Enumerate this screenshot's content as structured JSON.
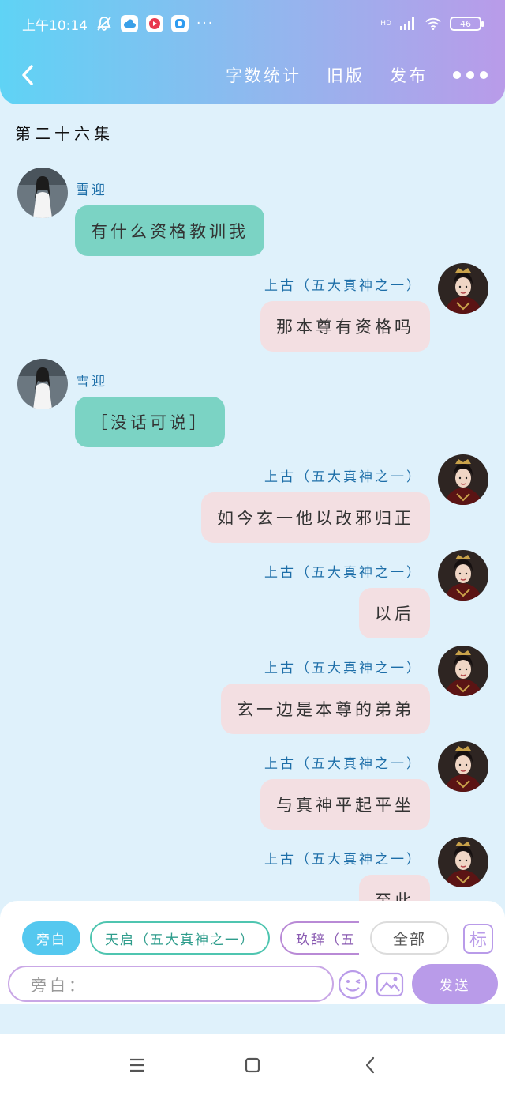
{
  "status_bar": {
    "time": "上午10:14",
    "more": "···",
    "network": "HD",
    "battery": "46"
  },
  "header": {
    "actions": [
      "字数统计",
      "旧版",
      "发布"
    ]
  },
  "episode_title": "第二十六集",
  "messages": [
    {
      "side": "left",
      "name": "雪迎",
      "text": "有什么资格教训我"
    },
    {
      "side": "right",
      "name": "上古（五大真神之一）",
      "text": "那本尊有资格吗"
    },
    {
      "side": "left",
      "name": "雪迎",
      "text": "［没话可说］"
    },
    {
      "side": "right",
      "name": "上古（五大真神之一）",
      "text": "如今玄一他以改邪归正"
    },
    {
      "side": "right",
      "name": "上古（五大真神之一）",
      "text": "以后"
    },
    {
      "side": "right",
      "name": "上古（五大真神之一）",
      "text": "玄一边是本尊的弟弟"
    },
    {
      "side": "right",
      "name": "上古（五大真神之一）",
      "text": "与真神平起平坐"
    },
    {
      "side": "right",
      "name": "上古（五大真神之一）",
      "text": "至此"
    }
  ],
  "composer": {
    "role_chips": [
      "旁白",
      "天启（五大真神之一）",
      "玖辞（五"
    ],
    "all_label": "全部",
    "tag_label": "标",
    "input_placeholder": "旁白：",
    "send_label": "发送"
  },
  "colors": {
    "header_start": "#5fd3f5",
    "header_end": "#b99be9",
    "left_bubble": "#7bd3c4",
    "right_bubble": "#f3dfe2",
    "background": "#dff1fb",
    "accent_purple": "#b99be9"
  }
}
